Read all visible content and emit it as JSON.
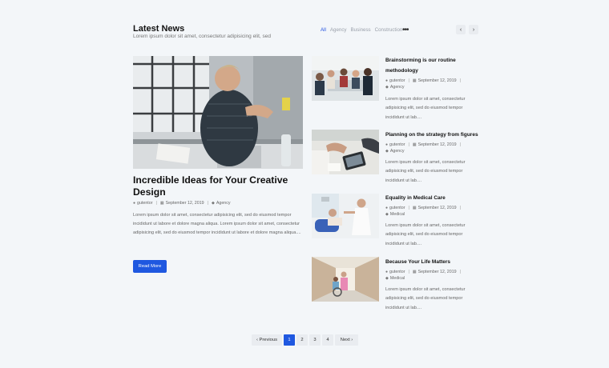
{
  "header": {
    "title": "Latest News",
    "subtitle": "Lorem ipsum dolor sit amet, consectetur adipisicing elit, sed",
    "more_icon": "•••",
    "prev_icon": "‹",
    "next_icon": "›"
  },
  "tabs": [
    {
      "label": "All",
      "active": true
    },
    {
      "label": "Agency",
      "active": false
    },
    {
      "label": "Business",
      "active": false
    },
    {
      "label": "Construction",
      "active": false
    }
  ],
  "featured": {
    "image_icon": "office-man-photo",
    "title": "Incredible Ideas for Your Creative Design",
    "author": "gutentor",
    "date": "September 12, 2019",
    "category": "Agency",
    "excerpt": "Lorem ipsum dolor sit amet, consectetur adipisicing elit, sed do eiusmod tempor incididunt ut labore et dolore magna aliqua. Lorem ipsum dolor sit amet, consectetur adipisicing elit, sed do eiusmod tempor incididunt ut labore et dolore magna aliqua....",
    "button_label": "Read More"
  },
  "cards": [
    {
      "image_icon": "meeting-photo",
      "title": "Brainstorming is our routine methodology",
      "author": "gutentor",
      "date": "September 12, 2019",
      "category": "Agency",
      "excerpt": "Lorem ipsum dolor sit amet, consectetur adipisicing elit, sed do eiusmod tempor incididunt ut lab...."
    },
    {
      "image_icon": "tablet-planning-photo",
      "title": "Planning on the strategy from figures",
      "author": "gutentor",
      "date": "September 12, 2019",
      "category": "Agency",
      "excerpt": "Lorem ipsum dolor sit amet, consectetur adipisicing elit, sed do eiusmod tempor incididunt ut lab...."
    },
    {
      "image_icon": "dentist-photo",
      "title": "Equality in Medical Care",
      "author": "gutentor",
      "date": "September 12, 2019",
      "category": "Medical",
      "excerpt": "Lorem ipsum dolor sit amet, consectetur adipisicing elit, sed do eiusmod tempor incididunt ut lab...."
    },
    {
      "image_icon": "hospital-corridor-photo",
      "title": "Because Your Life Matters",
      "author": "gutentor",
      "date": "September 12, 2019",
      "category": "Medical",
      "excerpt": "Lorem ipsum dolor sit amet, consectetur adipisicing elit, sed do eiusmod tempor incididunt ut lab...."
    }
  ],
  "pagination": {
    "previous": "‹ Previous",
    "pages": [
      "1",
      "2",
      "3",
      "4"
    ],
    "current": "1",
    "next": "Next ›"
  },
  "colors": {
    "accent": "#1f58e0",
    "background": "#f3f6f9"
  }
}
